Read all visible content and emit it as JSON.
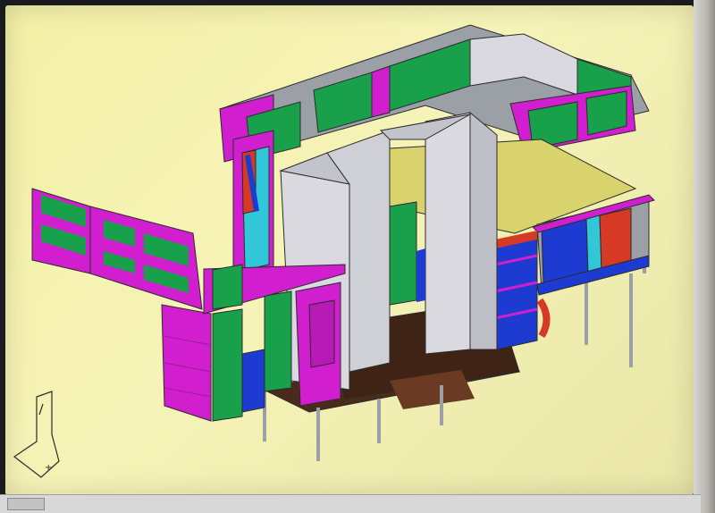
{
  "screen": {
    "background_color": "#f3f0a6"
  },
  "model": {
    "palette": {
      "magenta": "#d11fcf",
      "green": "#18a14a",
      "gray": "#d9d9df",
      "dark_gray": "#9aa0a6",
      "blue": "#1e3bd1",
      "cyan": "#31c7d9",
      "red": "#d63a25",
      "olive": "#d8d36c",
      "brown": "#4a2a1a",
      "dark_brown": "#6a3a22",
      "outline": "#2b2b2b",
      "leg": "#c9c9cf"
    }
  },
  "ucs": {
    "icon": "ucs-axis-icon"
  },
  "taskbar": {
    "items": [
      "",
      "",
      "",
      "",
      ""
    ]
  }
}
